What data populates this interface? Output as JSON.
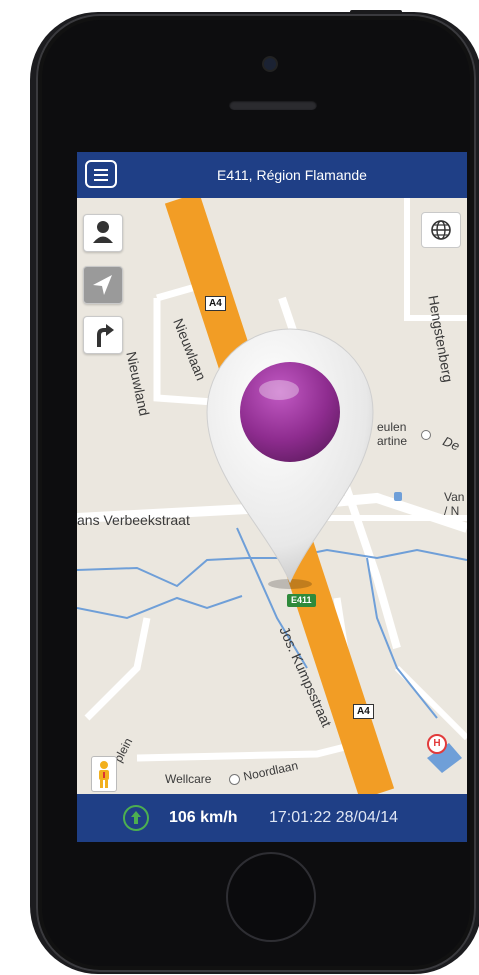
{
  "header": {
    "title": "E411, Région Flamande"
  },
  "map": {
    "labels": {
      "nieuwland": "Nieuwland",
      "nieuwlaan": "Nieuwlaan",
      "hengstenberg": "Hengstenberg",
      "meulen": "eulen",
      "martine": "artine",
      "de": "De",
      "van": "Van",
      "slash_n": "/ N",
      "verbeekstraat": "ans Verbeekstraat",
      "kumpsstraat": "Jos. Kumpsstraat",
      "wellcare": "Wellcare",
      "noordlaan": "Noordlaan",
      "plein": "plein"
    },
    "shields": {
      "a4_top": "A4",
      "a4_bottom": "A4",
      "e411": "E411"
    },
    "hospital": "H"
  },
  "footer": {
    "speed": "106 km/h",
    "datetime": "17:01:22 28/04/14"
  },
  "colors": {
    "bar": "#1f3f86",
    "highway": "#f29d25",
    "pin": "#8e2c8f",
    "water": "#6f9fd8"
  }
}
